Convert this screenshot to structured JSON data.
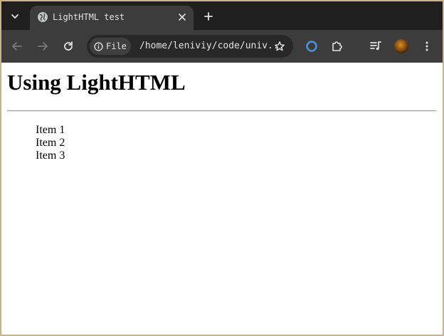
{
  "browser": {
    "tab": {
      "title": "LightHTML test"
    },
    "address_bar": {
      "chip_label": "File",
      "url": "/home/leniviy/code/univ..."
    }
  },
  "page": {
    "heading": "Using LightHTML",
    "list_items": [
      "Item 1",
      "Item 2",
      "Item 3"
    ]
  },
  "icons": {
    "tab_search": "chevron-down-icon",
    "favicon": "globe-icon",
    "tab_close": "close-icon",
    "new_tab": "plus-icon",
    "back": "arrow-left-icon",
    "forward": "arrow-right-icon",
    "reload": "reload-icon",
    "site_info": "info-icon",
    "bookmark": "star-icon",
    "extension_1": "ring-icon",
    "extensions": "puzzle-icon",
    "reading_list": "queue-music-icon",
    "profile": "avatar",
    "menu": "kebab-menu-icon"
  },
  "colors": {
    "frame": "#c8b48c",
    "tabstrip_bg": "#1f1f1f",
    "toolbar_bg": "#3c3c3c",
    "omnibox_bg": "#282828",
    "icon": "#c4c7c5",
    "icon_disabled": "#7a7a7a",
    "extension_ring": "#4a90d9"
  }
}
